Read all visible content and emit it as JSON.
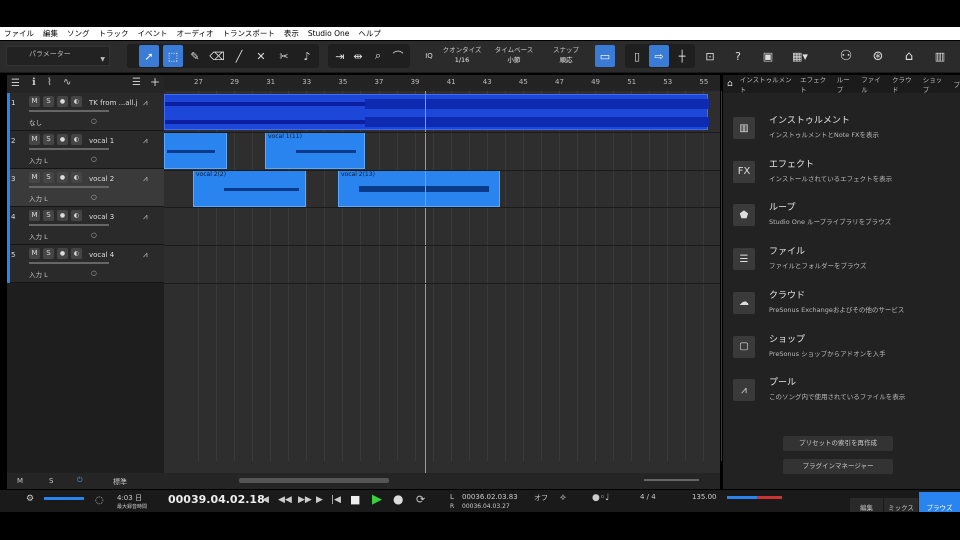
{
  "menu": [
    "ファイル",
    "編集",
    "ソング",
    "トラック",
    "イベント",
    "オーディオ",
    "トランスポート",
    "表示",
    "Studio One",
    "ヘルプ"
  ],
  "toolbar": {
    "param_label": "パラメーター",
    "quantize_label": "クオンタイズ",
    "quantize_value": "1/16",
    "timebase_label": "タイムベース",
    "timebase_value": "小節",
    "snap_label": "スナップ",
    "snap_value": "順応",
    "iq_label": "IQ"
  },
  "ruler": [
    "27",
    "29",
    "31",
    "33",
    "35",
    "37",
    "39",
    "41",
    "43",
    "45",
    "47",
    "49",
    "51",
    "53",
    "55"
  ],
  "tracks": [
    {
      "num": "1",
      "name": "TK from ...all.j",
      "input": "なし",
      "selected": false
    },
    {
      "num": "2",
      "name": "vocal 1",
      "input": "入力 L",
      "selected": false
    },
    {
      "num": "3",
      "name": "vocal 2",
      "input": "入力 L",
      "selected": true
    },
    {
      "num": "4",
      "name": "vocal 3",
      "input": "入力 L",
      "selected": false
    },
    {
      "num": "5",
      "name": "vocal 4",
      "input": "入力 L",
      "selected": false
    }
  ],
  "clips": {
    "vocal1_a": "",
    "vocal1_b": "vocal 1(11)",
    "vocal2_a": "vocal 2(2)",
    "vocal2_b": "vocal 2(13)"
  },
  "track_footer": {
    "m": "M",
    "s": "S",
    "mode": "標準"
  },
  "browser": {
    "tabs": [
      "インストゥルメント",
      "エフェクト",
      "ループ",
      "ファイル",
      "クラウド",
      "ショップ",
      "プ"
    ],
    "items": [
      {
        "title": "インストゥルメント",
        "desc": "インストゥルメントとNote FXを表示",
        "icon": "piano-icon"
      },
      {
        "title": "エフェクト",
        "desc": "インストールされているエフェクトを表示",
        "icon": "fx-icon"
      },
      {
        "title": "ループ",
        "desc": "Studio One ループライブラリをブラウズ",
        "icon": "loop-icon"
      },
      {
        "title": "ファイル",
        "desc": "ファイルとフォルダーをブラウズ",
        "icon": "file-list-icon"
      },
      {
        "title": "クラウド",
        "desc": "PreSonus Exchangeおよびその他のサービス",
        "icon": "cloud-icon"
      },
      {
        "title": "ショップ",
        "desc": "PreSonus ショップからアドオンを入手",
        "icon": "shop-icon"
      },
      {
        "title": "プール",
        "desc": "このソング内で使用されているファイルを表示",
        "icon": "pool-icon"
      }
    ],
    "rebuild_button": "プリセットの索引を再作成",
    "plugin_manager_button": "プラグインマネージャー"
  },
  "transport": {
    "time_small": "4:03 日",
    "time_sub": "最大録音時間",
    "position": "00039.04.02.18",
    "loop_start": "00036.02.03.83",
    "loop_end": "00036.04.03.27",
    "l_label": "L",
    "r_label": "R",
    "off": "オフ",
    "signature": "4 / 4",
    "tempo": "135.00",
    "tab_edit": "編集",
    "tab_mix": "ミックス",
    "tab_browse": "ブラウズ"
  }
}
